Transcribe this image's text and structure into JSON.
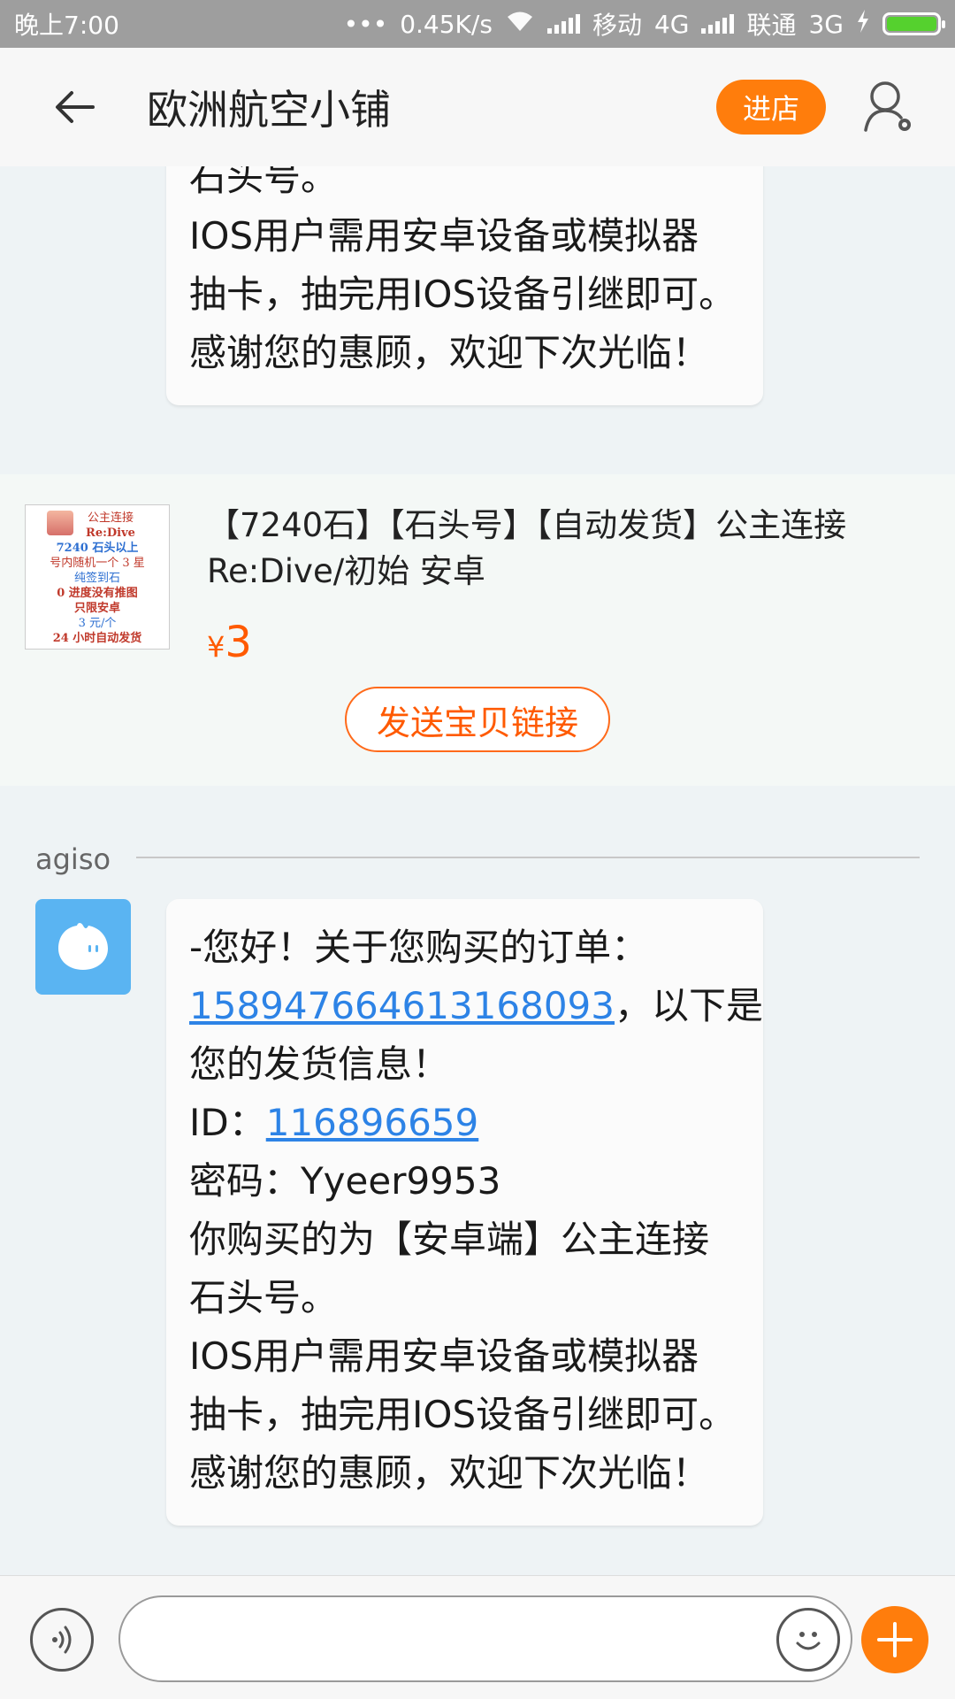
{
  "status_bar": {
    "time": "晚上7:00",
    "dots": "•••",
    "speed": "0.45K/s",
    "carrier1": "移动",
    "network1": "4G",
    "carrier2": "联通",
    "network2": "3G",
    "battery_color": "#55d12e"
  },
  "header": {
    "back_icon": "arrow-left-icon",
    "title": "欧洲航空小铺",
    "enter_store": "进店",
    "profile_icon": "user-settings-icon"
  },
  "messages": {
    "top_partial": [
      "石头号。",
      "IOS用户需用安卓设备或模拟器",
      "抽卡，抽完用IOS设备引继即可。",
      "感谢您的惠顾，欢迎下次光临！"
    ],
    "product": {
      "thumb_lines": [
        "公主连接",
        "Re:Dive",
        "7240 石头以上",
        "号内随机一个 3 星",
        "纯签到石",
        "0 进度没有推图",
        "只限安卓",
        "3 元/个",
        "24 小时自动发货"
      ],
      "title_line1": "【7240石】【石头号】【自动发货】公主连接",
      "title_line2": "Re:Dive/初始 安卓",
      "currency": "¥",
      "price": "3",
      "send_link": "发送宝贝链接"
    },
    "sender": "agiso",
    "bubble": {
      "line1": "-您好！关于您购买的订单：",
      "order_id": "1589476646131680​93",
      "line2_suffix": "，以下是",
      "line3": "您的发货信息！",
      "id_label": "ID：",
      "id_value": "116896659",
      "password": "密码：Yyeer9953",
      "line6": "你购买的为【安卓端】公主连接",
      "line7": "石头号。",
      "line8": "IOS用户需用安卓设备或模拟器",
      "line9": "抽卡，抽完用IOS设备引继即可。",
      "line10": "感谢您的惠顾，欢迎下次光临！"
    }
  },
  "input_bar": {
    "voice_icon": "voice-icon",
    "input_placeholder": "",
    "emoji_icon": "emoji-icon",
    "plus_icon": "plus-icon",
    "accent": "#ff7d0c"
  }
}
